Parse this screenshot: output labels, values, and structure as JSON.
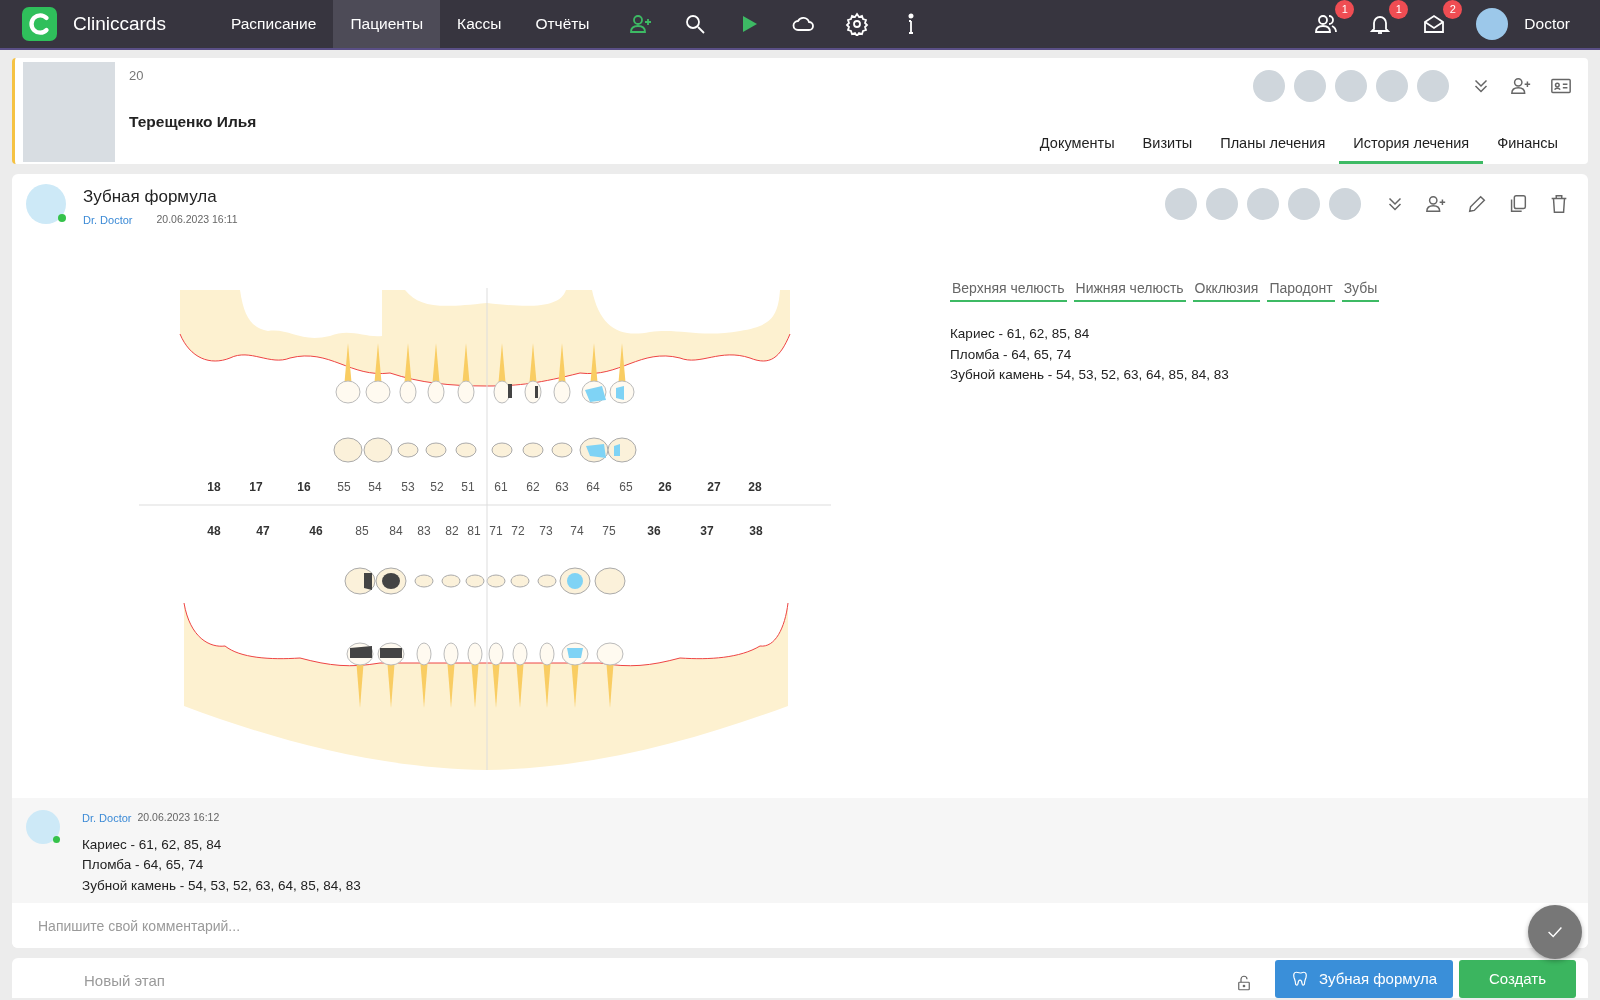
{
  "navbar": {
    "brand": "Cliniccards",
    "menu": [
      {
        "label": "Расписание",
        "selected": false
      },
      {
        "label": "Пациенты",
        "selected": true
      },
      {
        "label": "Кассы",
        "selected": false
      },
      {
        "label": "Отчёты",
        "selected": false
      }
    ],
    "notifications": [
      {
        "kind": "users",
        "count": "1"
      },
      {
        "kind": "bell",
        "count": "1"
      },
      {
        "kind": "mail",
        "count": "2"
      }
    ],
    "user": "Doctor"
  },
  "patient": {
    "age": "20",
    "name": "Терещенко Илья",
    "tabs": [
      {
        "label": "Документы",
        "selected": false
      },
      {
        "label": "Визиты",
        "selected": false
      },
      {
        "label": "Планы лечения",
        "selected": false
      },
      {
        "label": "История лечения",
        "selected": true
      },
      {
        "label": "Финансы",
        "selected": false
      }
    ]
  },
  "record": {
    "title": "Зубная формула",
    "author": "Dr. Doctor",
    "date": "20.06.2023 16:11",
    "chart_tabs": [
      "Верхняя челюсть",
      "Нижняя челюсть",
      "Окклюзия",
      "Пародонт",
      "Зубы"
    ],
    "summary": [
      "Кариес - 61, 62, 85, 84",
      "Пломба - 64, 65, 74",
      "Зубной камень - 54, 53, 52, 63, 64, 85, 84, 83"
    ],
    "upper_numbers": [
      {
        "label": "18",
        "kind": "permanent"
      },
      {
        "label": "17",
        "kind": "permanent"
      },
      {
        "label": "16",
        "kind": "permanent"
      },
      {
        "label": "55",
        "kind": "primary"
      },
      {
        "label": "54",
        "kind": "primary"
      },
      {
        "label": "53",
        "kind": "primary"
      },
      {
        "label": "52",
        "kind": "primary"
      },
      {
        "label": "51",
        "kind": "primary"
      },
      {
        "label": "61",
        "kind": "primary"
      },
      {
        "label": "62",
        "kind": "primary"
      },
      {
        "label": "63",
        "kind": "primary"
      },
      {
        "label": "64",
        "kind": "primary"
      },
      {
        "label": "65",
        "kind": "primary"
      },
      {
        "label": "26",
        "kind": "permanent"
      },
      {
        "label": "27",
        "kind": "permanent"
      },
      {
        "label": "28",
        "kind": "permanent"
      }
    ],
    "lower_numbers": [
      {
        "label": "48",
        "kind": "permanent"
      },
      {
        "label": "47",
        "kind": "permanent"
      },
      {
        "label": "46",
        "kind": "permanent"
      },
      {
        "label": "85",
        "kind": "primary"
      },
      {
        "label": "84",
        "kind": "primary"
      },
      {
        "label": "83",
        "kind": "primary"
      },
      {
        "label": "82",
        "kind": "primary"
      },
      {
        "label": "81",
        "kind": "primary"
      },
      {
        "label": "71",
        "kind": "primary"
      },
      {
        "label": "72",
        "kind": "primary"
      },
      {
        "label": "73",
        "kind": "primary"
      },
      {
        "label": "74",
        "kind": "primary"
      },
      {
        "label": "75",
        "kind": "primary"
      },
      {
        "label": "36",
        "kind": "permanent"
      },
      {
        "label": "37",
        "kind": "permanent"
      },
      {
        "label": "38",
        "kind": "permanent"
      }
    ]
  },
  "comment": {
    "author": "Dr. Doctor",
    "date": "20.06.2023 16:12",
    "lines": [
      "Кариес - 61, 62, 85, 84",
      "Пломба - 64, 65, 74",
      "Зубной камень - 54, 53, 52, 63, 64, 85, 84, 83"
    ]
  },
  "comment_field": {
    "placeholder": "Напишите свой комментарий..."
  },
  "stage_field": {
    "placeholder": "Новый этап"
  },
  "buttons": [
    {
      "label": "Зубная формула",
      "kind": "formula"
    },
    {
      "label": "Создать",
      "kind": "create"
    }
  ]
}
